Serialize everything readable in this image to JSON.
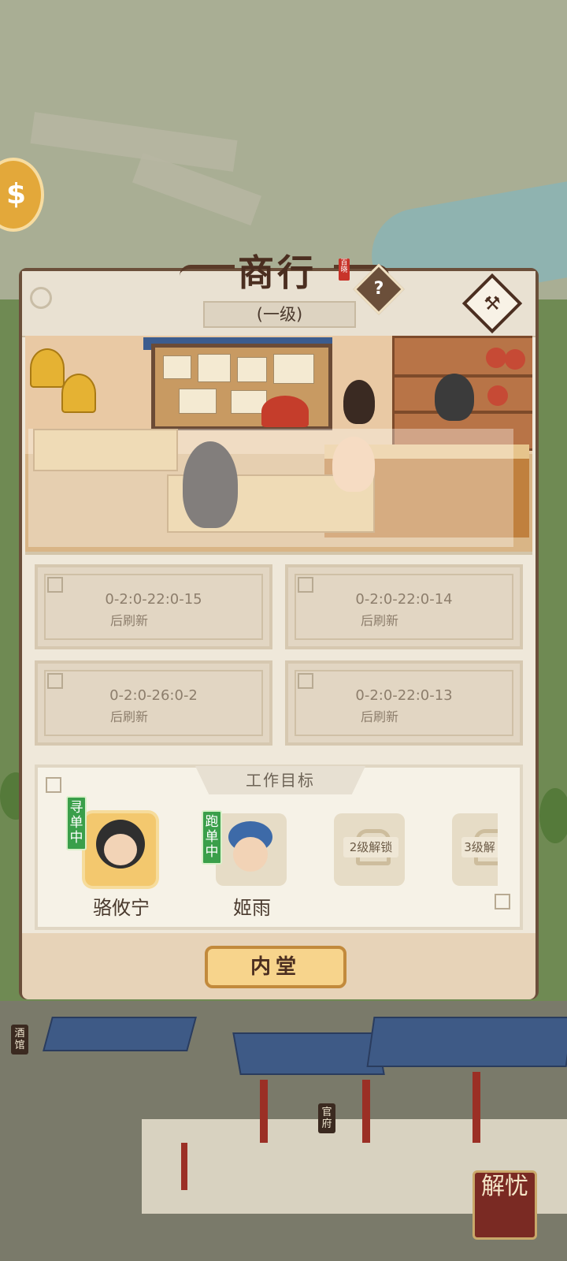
{
  "panel": {
    "title": "商行",
    "seal_text": "百晓",
    "level_text": "(一级)",
    "help_label": "?",
    "hammer_icon": "hammer-icon"
  },
  "tasks": [
    {
      "line1": "0-2:0-22:0-15",
      "line2": "后刷新"
    },
    {
      "line1": "0-2:0-22:0-14",
      "line2": "后刷新"
    },
    {
      "line1": "0-2:0-26:0-2",
      "line2": "后刷新"
    },
    {
      "line1": "0-2:0-22:0-13",
      "line2": "后刷新"
    }
  ],
  "goals": {
    "title": "工作目标",
    "slots": [
      {
        "name": "骆攸宁",
        "badge": "寻单中"
      },
      {
        "name": "姬雨",
        "badge": "跑单中"
      },
      {
        "lock": "2级解锁"
      },
      {
        "lock": "3级解"
      }
    ]
  },
  "buttons": {
    "inner_hall": "内堂"
  },
  "map": {
    "sign_tavern": "酒馆",
    "sign_office": "官府",
    "jieyou": "解忧"
  },
  "colors": {
    "frame": "#6b4f3a",
    "badge_green": "#3a9f4a",
    "button_gold": "#f7d48c"
  }
}
